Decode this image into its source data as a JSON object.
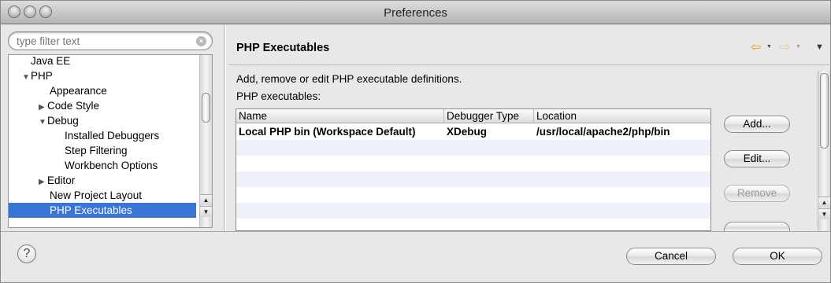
{
  "window": {
    "title": "Preferences"
  },
  "filter": {
    "placeholder": "type filter text",
    "clear_icon": "clear-icon"
  },
  "tree": [
    {
      "label": "Java EE",
      "arrow": ""
    },
    {
      "label": "PHP",
      "arrow": "▼"
    },
    {
      "label": "Appearance",
      "arrow": ""
    },
    {
      "label": "Code Style",
      "arrow": "▶"
    },
    {
      "label": "Debug",
      "arrow": "▼"
    },
    {
      "label": "Installed Debuggers",
      "arrow": ""
    },
    {
      "label": "Step Filtering",
      "arrow": ""
    },
    {
      "label": "Workbench Options",
      "arrow": ""
    },
    {
      "label": "Editor",
      "arrow": "▶"
    },
    {
      "label": "New Project Layout",
      "arrow": ""
    },
    {
      "label": "PHP Executables",
      "arrow": "",
      "selected": true
    }
  ],
  "page": {
    "title": "PHP Executables",
    "description": "Add, remove or edit PHP executable definitions.",
    "sublabel": "PHP executables:",
    "nav": {
      "back_icon": "back-arrow-icon",
      "forward_icon": "forward-arrow-icon",
      "menu_icon": "view-menu-icon"
    }
  },
  "table": {
    "columns": [
      "Name",
      "Debugger Type",
      "Location"
    ],
    "rows": [
      [
        "Local PHP bin (Workspace Default)",
        "XDebug",
        "/usr/local/apache2/php/bin"
      ]
    ]
  },
  "buttons": {
    "add": "Add...",
    "edit": "Edit...",
    "remove": "Remove",
    "cancel": "Cancel",
    "ok": "OK"
  },
  "help": {
    "glyph": "?"
  }
}
